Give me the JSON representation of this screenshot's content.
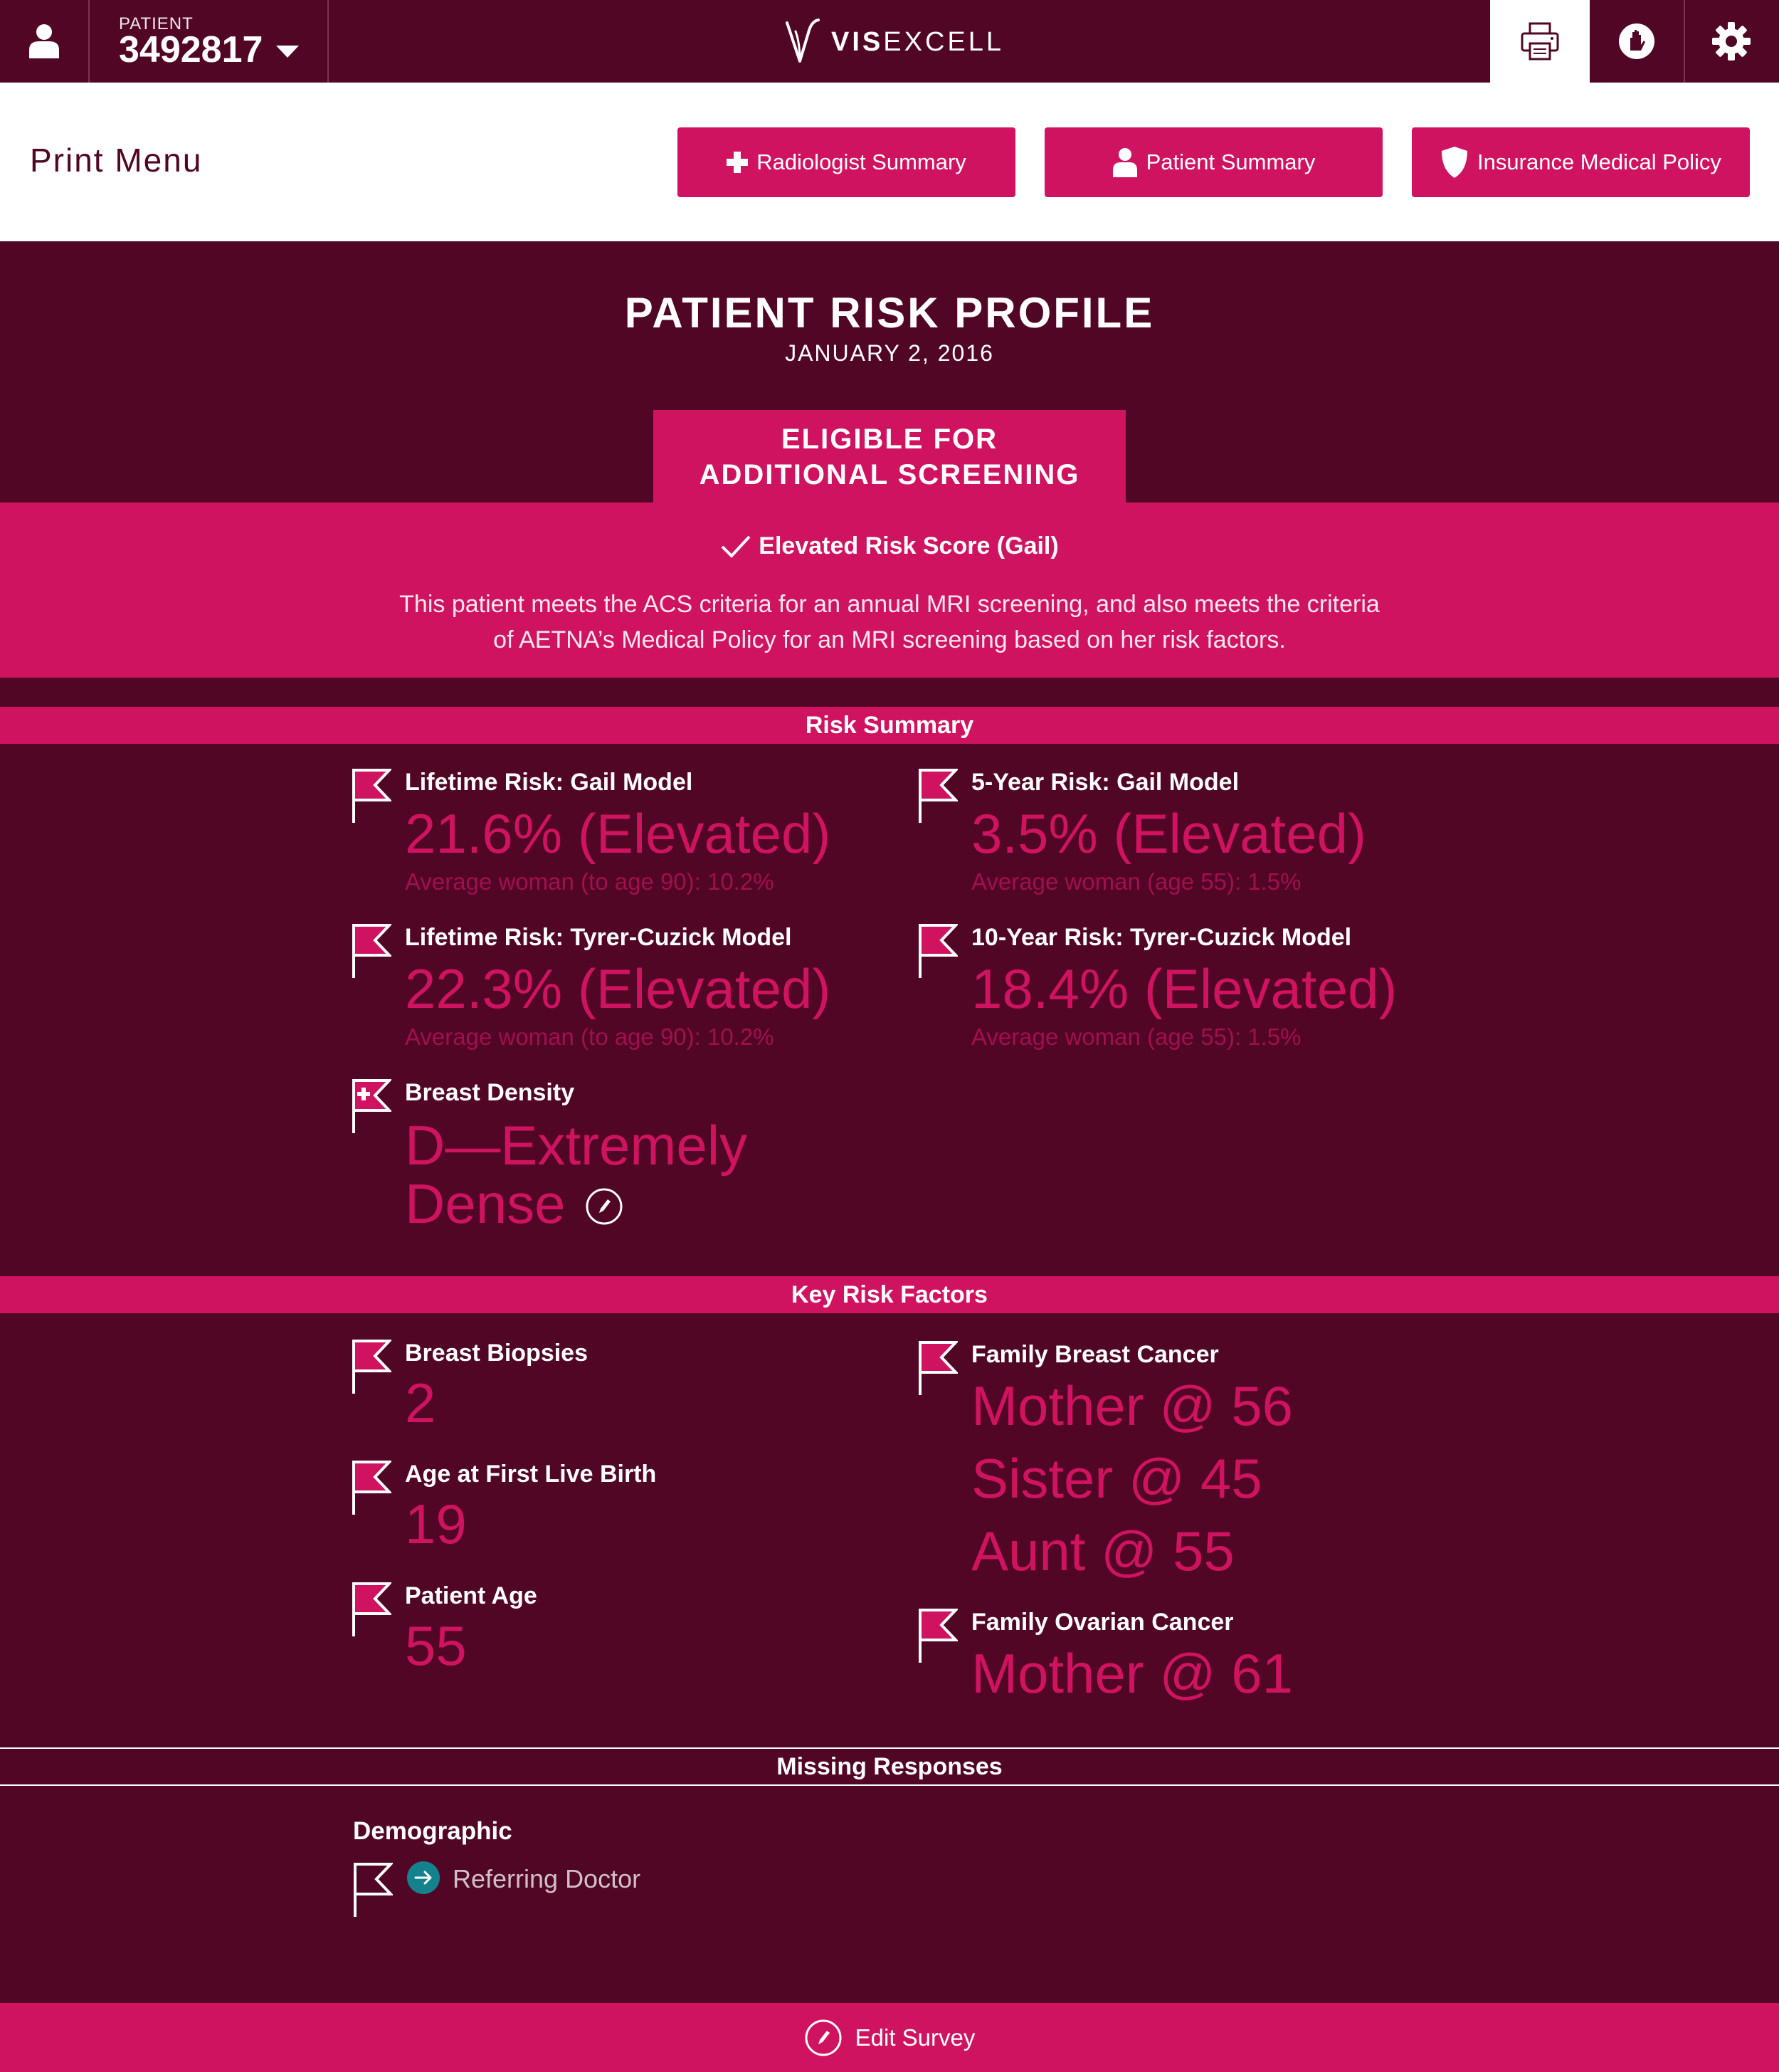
{
  "topbar": {
    "patient_label": "PATIENT",
    "patient_id": "3492817",
    "brand_bold": "VIS",
    "brand_light": "EXCELL",
    "icons": [
      "user-icon",
      "printer-icon",
      "hand-help-icon",
      "gear-icon"
    ]
  },
  "print_menu": {
    "title": "Print Menu",
    "buttons": [
      {
        "label": "Radiologist Summary",
        "icon": "plus-icon"
      },
      {
        "label": "Patient Summary",
        "icon": "user-icon"
      },
      {
        "label": "Insurance Medical Policy",
        "icon": "shield-icon"
      }
    ]
  },
  "profile": {
    "title": "PATIENT RISK PROFILE",
    "date": "JANUARY 2, 2016"
  },
  "eligibility": {
    "line1": "ELIGIBLE FOR",
    "line2": "ADDITIONAL SCREENING",
    "criterion": "Elevated Risk Score (Gail)",
    "description": "This patient meets the ACS criteria for an annual MRI screening, and also meets the criteria of AETNA’s Medical Policy for an MRI screening based on her risk factors."
  },
  "risk_summary": {
    "heading": "Risk Summary",
    "items": [
      {
        "label": "Lifetime Risk: Gail Model",
        "value": "21.6% (Elevated)",
        "average": "Average woman (to age 90): 10.2%"
      },
      {
        "label": "5-Year Risk: Gail Model",
        "value": "3.5% (Elevated)",
        "average": "Average woman (age 55): 1.5%"
      },
      {
        "label": "Lifetime Risk: Tyrer-Cuzick Model",
        "value": "22.3% (Elevated)",
        "average": "Average woman (to age 90): 10.2%"
      },
      {
        "label": "10-Year Risk: Tyrer-Cuzick Model",
        "value": "18.4% (Elevated)",
        "average": "Average woman (age 55): 1.5%"
      }
    ],
    "density": {
      "label": "Breast Density",
      "value_line1": "D—Extremely",
      "value_line2": "Dense"
    }
  },
  "key_risk_factors": {
    "heading": "Key Risk Factors",
    "left": [
      {
        "label": "Breast Biopsies",
        "value": "2"
      },
      {
        "label": "Age at First Live Birth",
        "value": "19"
      },
      {
        "label": "Patient Age",
        "value": "55"
      }
    ],
    "family_breast": {
      "label": "Family Breast Cancer",
      "values": [
        "Mother @ 56",
        "Sister @ 45",
        "Aunt @ 55"
      ]
    },
    "family_ovarian": {
      "label": "Family Ovarian Cancer",
      "values": [
        "Mother @ 61"
      ]
    }
  },
  "missing": {
    "heading": "Missing Responses",
    "category": "Demographic",
    "item": "Referring Doctor"
  },
  "footer": {
    "edit_label": "Edit Survey"
  },
  "colors": {
    "background": "#510626",
    "accent": "#d01360",
    "teal": "#14828c"
  }
}
